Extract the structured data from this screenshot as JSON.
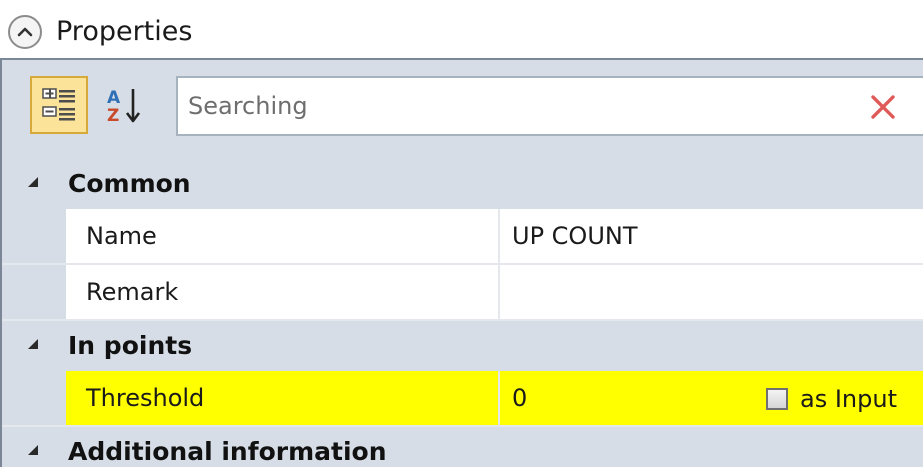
{
  "header": {
    "title": "Properties",
    "collapse_icon": "chevron-up-icon"
  },
  "toolbar": {
    "categorized_icon": "categorized-view-icon",
    "alphabetical_icon": "sort-alphabetical-icon",
    "search": {
      "placeholder": "Searching",
      "value": ""
    },
    "clear_icon": "close-icon",
    "colors": {
      "clear_icon": "#e05a5a",
      "active_button_bg": "#fbe39a"
    }
  },
  "grid": {
    "categories": [
      {
        "label": "Common",
        "properties": [
          {
            "name": "Name",
            "value": "UP COUNT"
          },
          {
            "name": "Remark",
            "value": ""
          }
        ]
      },
      {
        "label": "In points",
        "properties": [
          {
            "name": "Threshold",
            "value": "0",
            "as_input_label": "as Input",
            "as_input_checked": false,
            "highlight_color": "#ffff00"
          }
        ]
      },
      {
        "label": "Additional information",
        "properties": []
      }
    ]
  }
}
